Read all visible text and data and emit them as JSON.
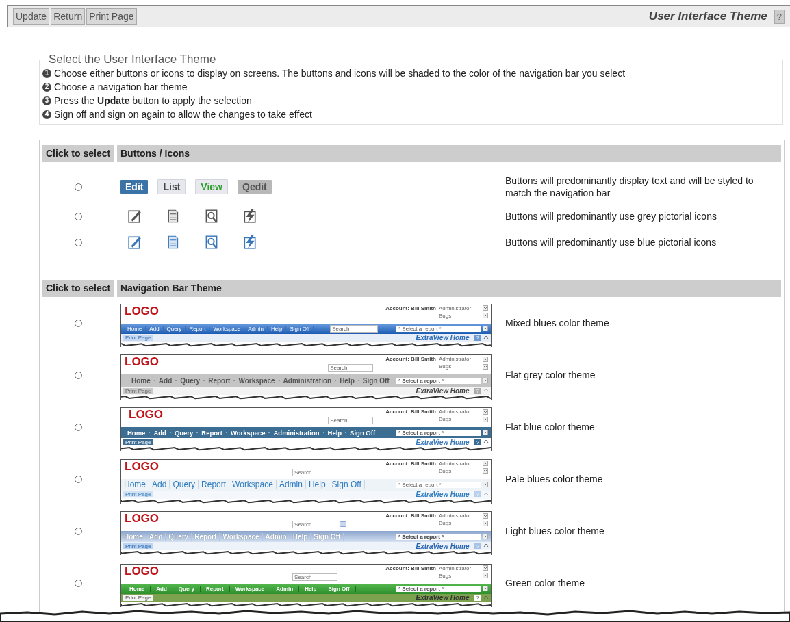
{
  "toolbar": {
    "buttons": [
      "Update",
      "Return",
      "Print Page"
    ],
    "title": "User Interface Theme",
    "help": "?"
  },
  "instructions": {
    "legend": "Select the User Interface Theme",
    "steps": [
      {
        "number": "1",
        "text": "Choose either buttons or icons to display on screens. The buttons and icons will be shaded to the color of the navigation bar you select"
      },
      {
        "number": "2",
        "text": "Choose a navigation bar theme"
      },
      {
        "number": "3",
        "text": "Press the **Update** button to apply the selection"
      },
      {
        "number": "4",
        "text": "Sign off and sign on again to allow the changes to take effect"
      }
    ]
  },
  "buttons_section": {
    "headers": [
      "Click to select",
      "Buttons / Icons"
    ],
    "options": [
      {
        "kind": "text_buttons",
        "selected": false,
        "buttons": [
          {
            "label": "Edit",
            "kind": "solid"
          },
          {
            "label": "List",
            "kind": "pale"
          },
          {
            "label": "View",
            "kind": "accent"
          },
          {
            "label": "Qedit",
            "kind": "muted"
          }
        ],
        "description": "Buttons will predominantly display text and will be styled to match the navigation bar"
      },
      {
        "kind": "grey_icons",
        "selected": false,
        "description": "Buttons will predominantly use grey pictorial icons"
      },
      {
        "kind": "blue_icons",
        "selected": false,
        "description": "Buttons will predominantly use blue pictorial icons"
      }
    ]
  },
  "nav_section": {
    "headers": [
      "Click to select",
      "Navigation Bar Theme"
    ],
    "themes": [
      {
        "kind": "mixed_blues",
        "selected": false,
        "preview": {
          "logo": "LOGO",
          "account": "Account: Bill Smith",
          "role": "Administrator",
          "project": "Bugs",
          "search": "Search",
          "nav": [
            "Home",
            "Add",
            "Query",
            "Report",
            "Workspace",
            "Admin",
            "Help",
            "Sign Off"
          ],
          "report": "* Select a report *",
          "print": "Print Page",
          "home": "ExtraView Home",
          "help": "?"
        },
        "description": "Mixed blues color theme"
      },
      {
        "kind": "flat_grey",
        "selected": false,
        "preview": {
          "logo": "LOGO",
          "account": "Account: Bill Smith",
          "role": "Administrator",
          "project": "Bugs",
          "search": "Search",
          "nav": [
            "Home",
            "Add",
            "Query",
            "Report",
            "Workspace",
            "Administration",
            "Help",
            "Sign Off"
          ],
          "report": "* Select a report *",
          "print": "Print Page",
          "home": "ExtraView Home",
          "help": "?"
        },
        "description": "Flat grey color theme"
      },
      {
        "kind": "flat_blue",
        "selected": false,
        "preview": {
          "logo": "LOGO",
          "account": "Account: Bill Smith",
          "role": "Administrator",
          "project": "Bugs",
          "search": "Search",
          "nav": [
            "Home",
            "Add",
            "Query",
            "Report",
            "Workspace",
            "Administration",
            "Help",
            "Sign Off"
          ],
          "report": "* Select a report *",
          "print": "Print Page",
          "home": "ExtraView Home",
          "help": "?"
        },
        "description": "Flat blue color theme"
      },
      {
        "kind": "pale_blues",
        "selected": false,
        "preview": {
          "logo": "LOGO",
          "account": "Account: Bill Smith",
          "role": "Administrator",
          "project": "Bugs",
          "search": "Search",
          "nav": [
            "Home",
            "Add",
            "Query",
            "Report",
            "Workspace",
            "Admin",
            "Help",
            "Sign Off"
          ],
          "report": "* Select a report *",
          "print": "Print Page",
          "home": "ExtraView Home",
          "help": "?"
        },
        "description": "Pale blues color theme"
      },
      {
        "kind": "light_blues",
        "selected": false,
        "preview": {
          "logo": "LOGO",
          "account": "Account: Bill Smith",
          "role": "Administrator",
          "project": "Bugs",
          "search": "Search",
          "nav": [
            "Home",
            "Add",
            "Query",
            "Report",
            "Workspace",
            "Admin",
            "Help",
            "Sign Off"
          ],
          "report": "* Select a report *",
          "print": "Print Page",
          "home": "ExtraView Home",
          "help": "?"
        },
        "description": "Light blues color theme"
      },
      {
        "kind": "green",
        "selected": false,
        "preview": {
          "logo": "LOGO",
          "account": "Account: Bill Smith",
          "role": "Administrator",
          "project": "Bugs",
          "search": "Search",
          "nav": [
            "Home",
            "Add",
            "Query",
            "Report",
            "Workspace",
            "Admin",
            "Help",
            "Sign Off"
          ],
          "report": "* Select a report *",
          "print": "Print Page",
          "home": "ExtraView Home",
          "help": "?"
        },
        "description": "Green color theme"
      }
    ]
  }
}
